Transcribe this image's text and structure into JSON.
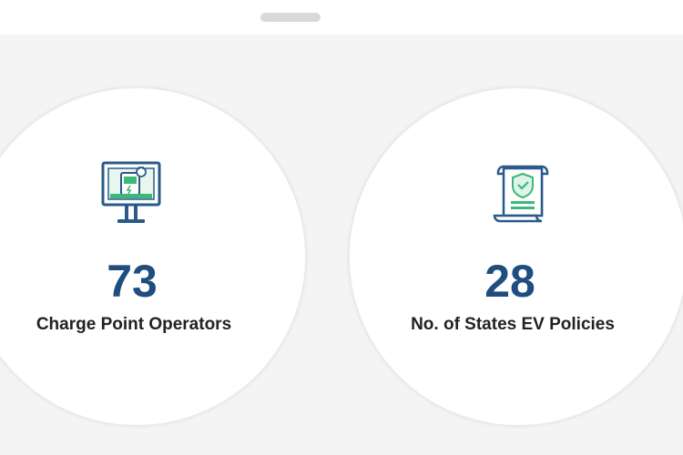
{
  "stats": [
    {
      "value": "73",
      "label": "Charge Point Operators",
      "icon": "charging-station-icon"
    },
    {
      "value": "28",
      "label": "No. of States EV Policies",
      "icon": "policy-document-icon"
    }
  ],
  "colors": {
    "value": "#1f4e7e",
    "label": "#222222",
    "icon_outline": "#2a5a8a",
    "icon_accent": "#3cb878",
    "background": "#f4f4f4",
    "card": "#ffffff"
  }
}
